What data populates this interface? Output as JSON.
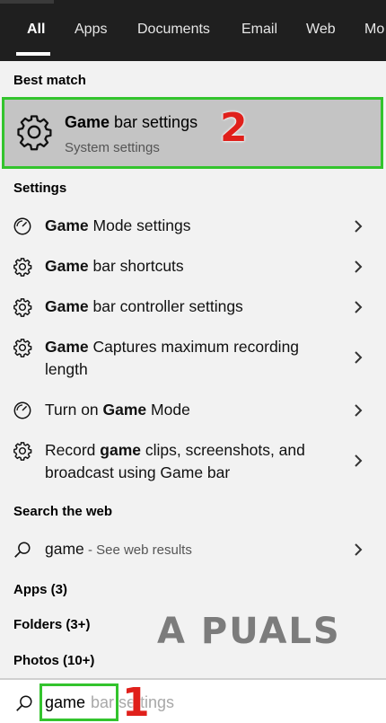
{
  "tabs": [
    "All",
    "Apps",
    "Documents",
    "Email",
    "Web",
    "Mo"
  ],
  "best_match": {
    "header": "Best match",
    "title_bold": "Game",
    "title_rest": " bar settings",
    "subtitle": "System settings",
    "step_number": "2"
  },
  "settings": {
    "header": "Settings",
    "items": [
      {
        "pre": "",
        "bold": "Game",
        "post": " Mode settings",
        "icon": "game-mode-icon"
      },
      {
        "pre": "",
        "bold": "Game",
        "post": " bar shortcuts",
        "icon": "gear-icon"
      },
      {
        "pre": "",
        "bold": "Game",
        "post": " bar controller settings",
        "icon": "gear-icon"
      },
      {
        "pre": "",
        "bold": "Game",
        "post": " Captures maximum recording length",
        "icon": "gear-icon"
      },
      {
        "pre": "Turn on ",
        "bold": "Game",
        "post": " Mode",
        "icon": "game-mode-icon"
      },
      {
        "pre": "Record ",
        "bold": "game",
        "post": " clips, screenshots, and broadcast using Game bar",
        "icon": "gear-icon"
      }
    ]
  },
  "web": {
    "header": "Search the web",
    "query": "game",
    "suffix": " - See web results"
  },
  "categories": [
    "Apps (3)",
    "Folders (3+)",
    "Photos (10+)"
  ],
  "watermark": "A  PUALS",
  "search": {
    "typed": "game",
    "ghost": "bar settings",
    "step_number": "1"
  },
  "colors": {
    "highlight_border": "#33c42d",
    "step_number": "#e0201b",
    "topbar": "#1f1f1f"
  }
}
